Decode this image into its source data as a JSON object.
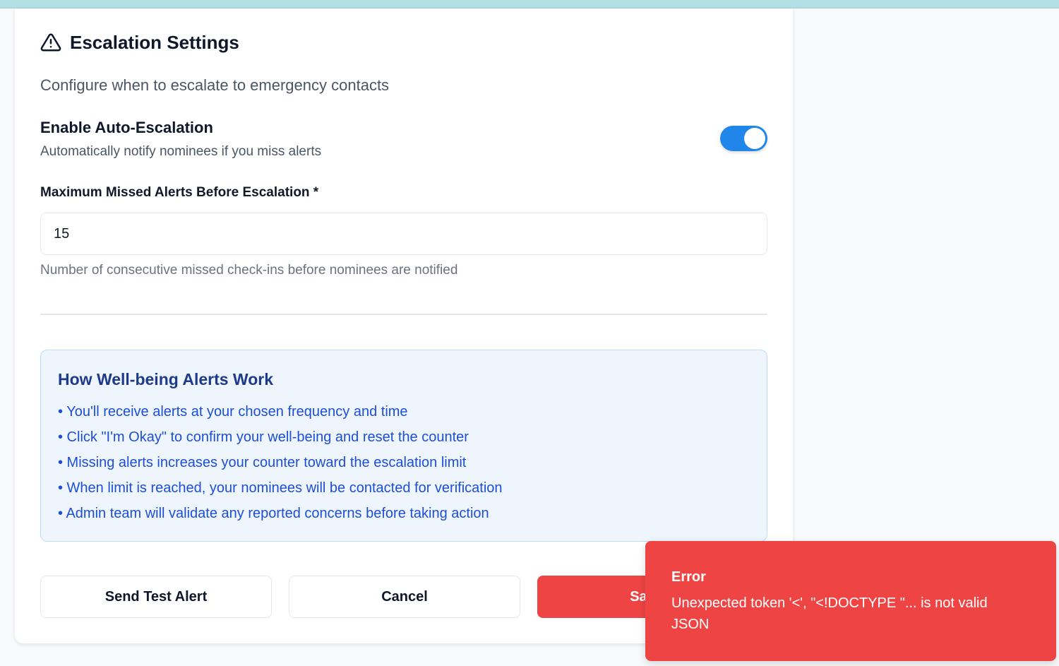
{
  "card": {
    "title": "Escalation Settings",
    "subtitle": "Configure when to escalate to emergency contacts",
    "auto_escalation": {
      "label": "Enable Auto-Escalation",
      "description": "Automatically notify nominees if you miss alerts",
      "enabled": true
    },
    "max_missed": {
      "label": "Maximum Missed Alerts Before Escalation *",
      "value": "15",
      "help": "Number of consecutive missed check-ins before nominees are notified"
    },
    "info": {
      "title": "How Well-being Alerts Work",
      "items": [
        "• You'll receive alerts at your chosen frequency and time",
        "• Click \"I'm Okay\" to confirm your well-being and reset the counter",
        "• Missing alerts increases your counter toward the escalation limit",
        "• When limit is reached, your nominees will be contacted for verification",
        "• Admin team will validate any reported concerns before taking action"
      ]
    },
    "buttons": {
      "send_test": "Send Test Alert",
      "cancel": "Cancel",
      "save": "Save S"
    }
  },
  "toast": {
    "title": "Error",
    "message": "Unexpected token '<', \"<!DOCTYPE \"... is not valid JSON"
  },
  "colors": {
    "accent": "#2086e9",
    "danger": "#ef4444",
    "info_bg": "#eef5fd",
    "info_text": "#1d4ed8"
  },
  "icons": {
    "title_icon": "warning-triangle-icon"
  }
}
